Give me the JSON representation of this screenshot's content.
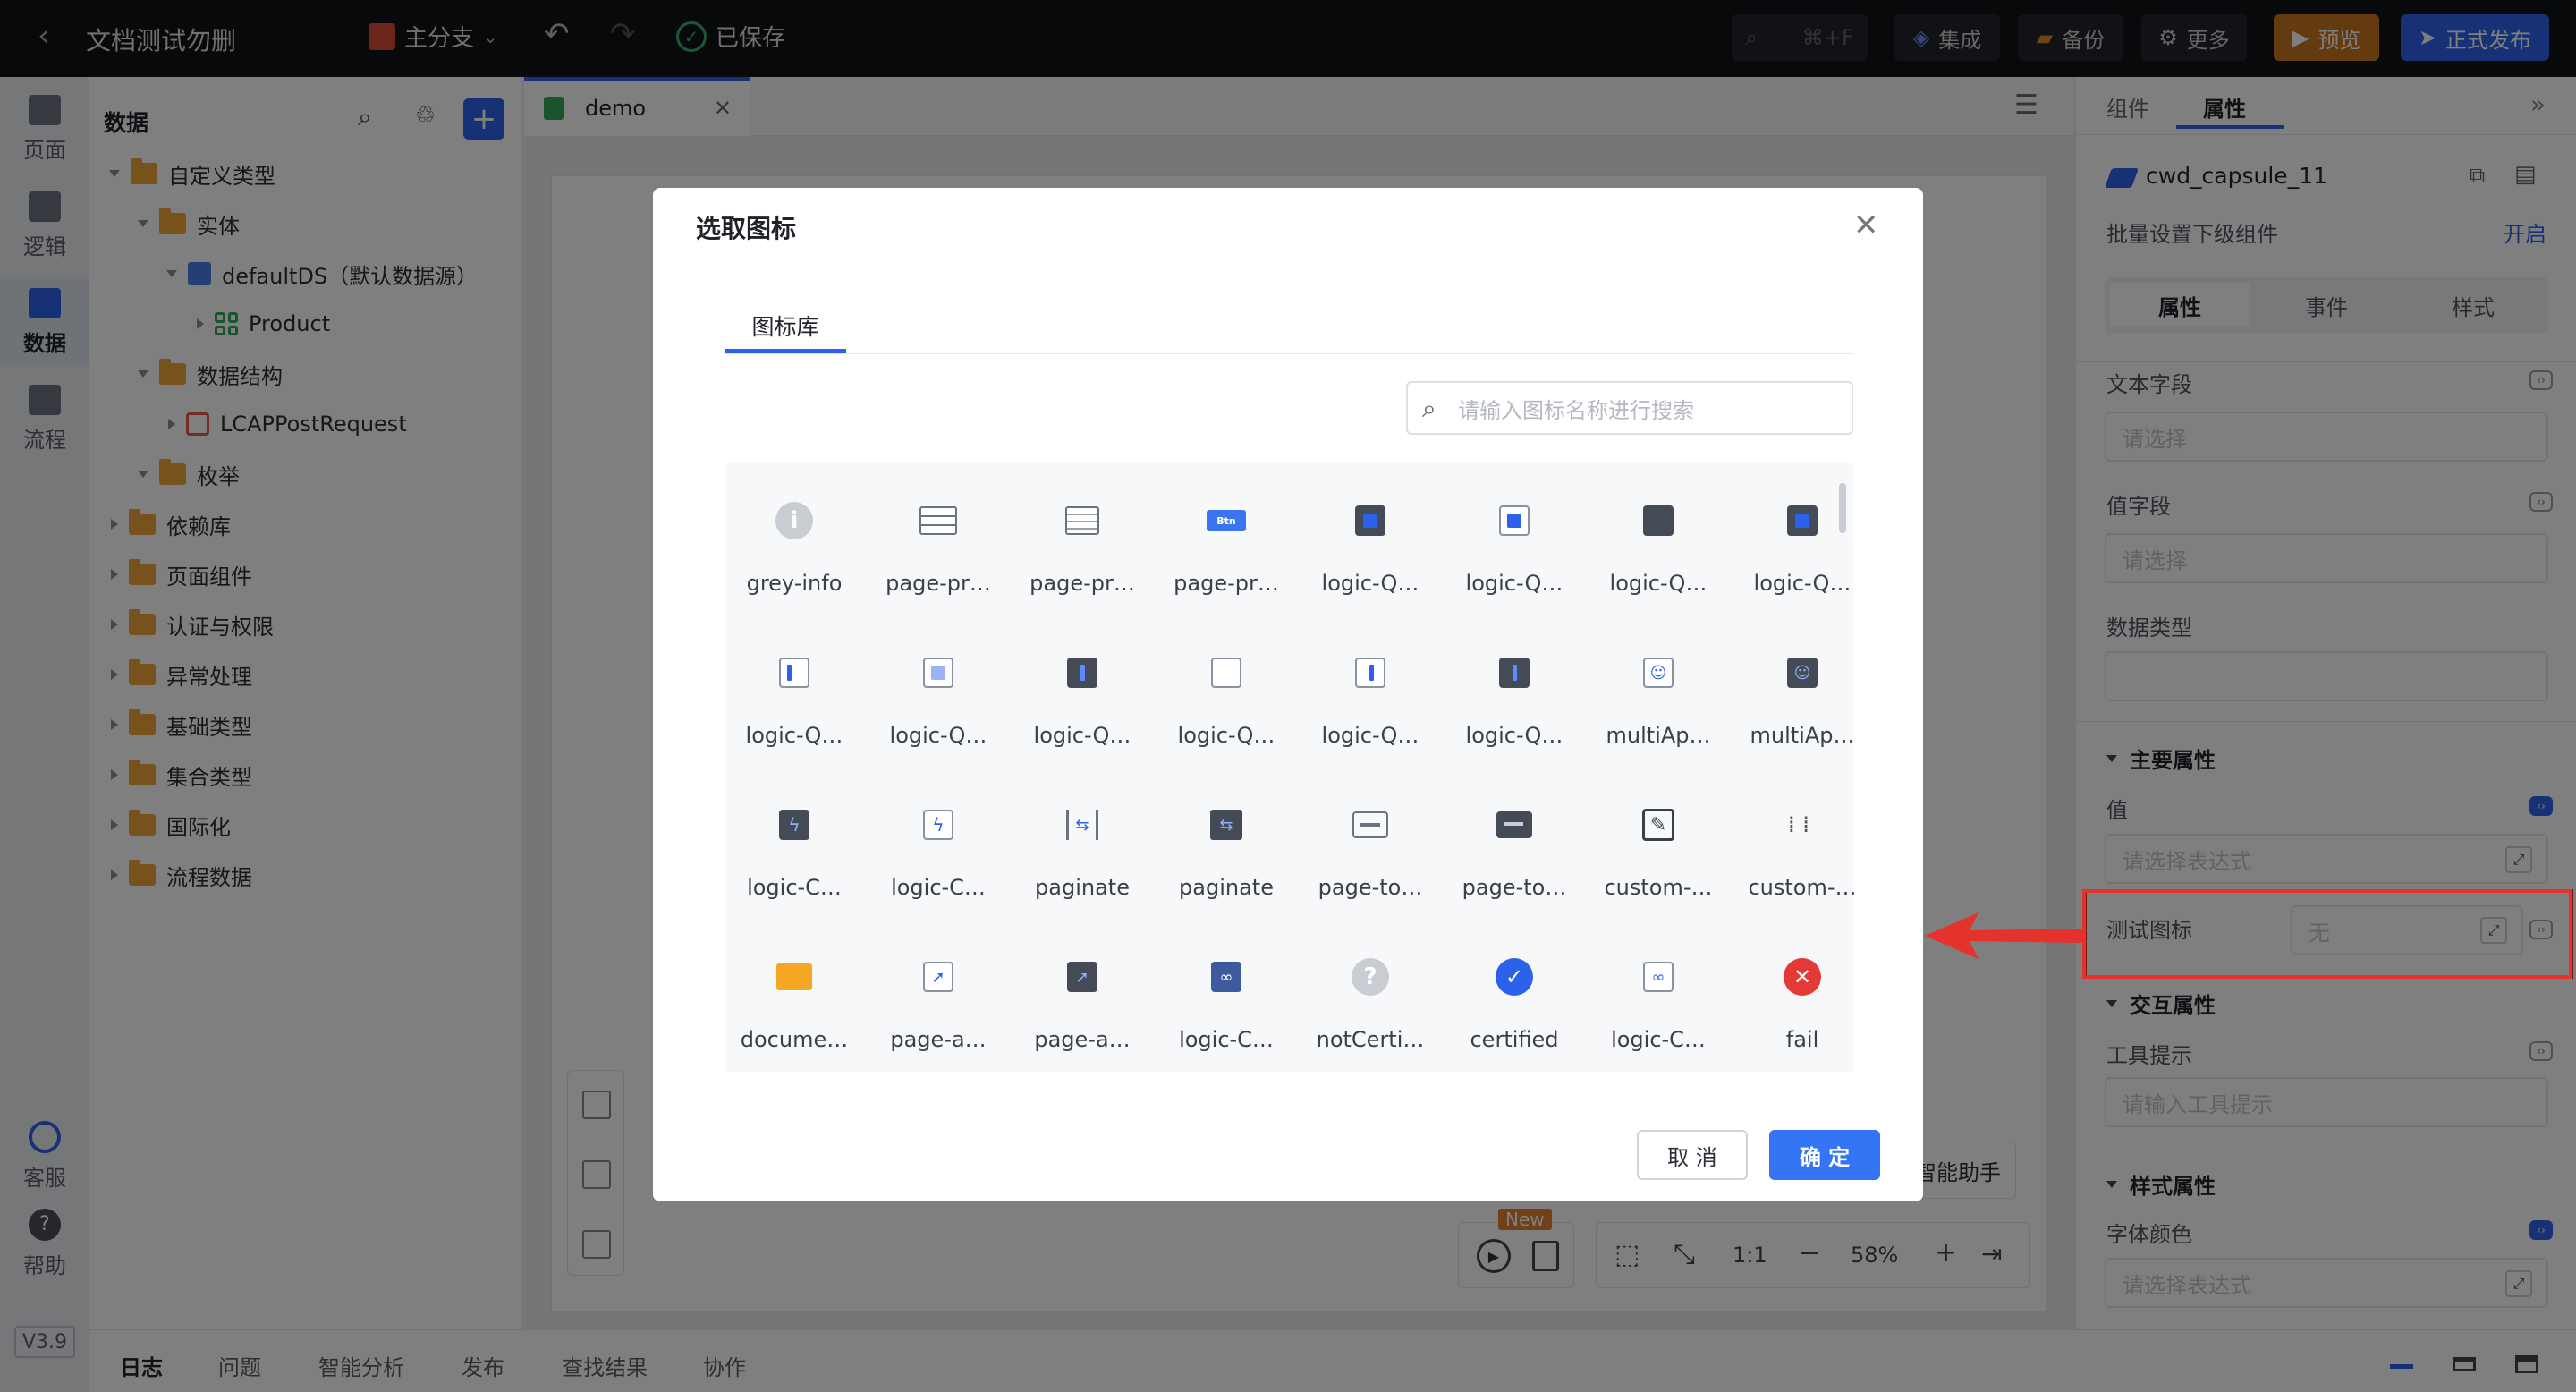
{
  "topbar": {
    "back": "‹",
    "project_title": "文档测试勿删",
    "branch": "主分支",
    "saved": "已保存",
    "search_shortcut": "⌘+F",
    "integrate": "集成",
    "backup": "备份",
    "more": "更多",
    "preview": "预览",
    "publish": "正式发布"
  },
  "left_rail": {
    "items": [
      {
        "label": "页面",
        "icon": "file-icon"
      },
      {
        "label": "逻辑",
        "icon": "logic-icon"
      },
      {
        "label": "数据",
        "icon": "database-icon"
      },
      {
        "label": "流程",
        "icon": "flow-icon"
      }
    ],
    "support": "客服",
    "help": "帮助",
    "version": "V3.9"
  },
  "tree": {
    "title": "数据",
    "rows": [
      {
        "label": "自定义类型",
        "icon": "folder",
        "expanded": true
      },
      {
        "label": "实体",
        "icon": "folder",
        "expanded": true
      },
      {
        "label": "defaultDS（默认数据源）",
        "icon": "db",
        "expanded": true
      },
      {
        "label": "Product",
        "icon": "entity",
        "expanded": false
      },
      {
        "label": "数据结构",
        "icon": "folder",
        "expanded": true
      },
      {
        "label": "LCAPPostRequest",
        "icon": "struct",
        "expanded": false
      },
      {
        "label": "枚举",
        "icon": "folder",
        "expanded": true
      },
      {
        "label": "依赖库",
        "icon": "folder",
        "expanded": false
      },
      {
        "label": "页面组件",
        "icon": "folder",
        "expanded": false
      },
      {
        "label": "认证与权限",
        "icon": "folder",
        "expanded": false
      },
      {
        "label": "异常处理",
        "icon": "folder",
        "expanded": false
      },
      {
        "label": "基础类型",
        "icon": "folder",
        "expanded": false
      },
      {
        "label": "集合类型",
        "icon": "folder",
        "expanded": false
      },
      {
        "label": "国际化",
        "icon": "folder",
        "expanded": false
      },
      {
        "label": "流程数据",
        "icon": "folder",
        "expanded": false
      }
    ]
  },
  "editor": {
    "tab": "demo",
    "assistant": "智能助手",
    "new_badge": "New",
    "ratio": "1:1",
    "zoom": "58%"
  },
  "right_panel": {
    "tabs": [
      "组件",
      "属性"
    ],
    "component_name": "cwd_capsule_11",
    "batch_label": "批量设置下级组件",
    "batch_action": "开启",
    "sub_tabs": [
      "属性",
      "事件",
      "样式"
    ],
    "text_field": {
      "label": "文本字段",
      "placeholder": "请选择"
    },
    "value_field": {
      "label": "值字段",
      "placeholder": "请选择"
    },
    "data_type": {
      "label": "数据类型"
    },
    "main_section": "主要属性",
    "value": {
      "label": "值",
      "placeholder": "请选择表达式"
    },
    "test_icon": {
      "label": "测试图标",
      "value": "无"
    },
    "interact_section": "交互属性",
    "tooltip": {
      "label": "工具提示",
      "placeholder": "请输入工具提示"
    },
    "style_section": "样式属性",
    "font_color": {
      "label": "字体颜色",
      "placeholder": "请选择表达式"
    }
  },
  "bottom_bar": [
    "日志",
    "问题",
    "智能分析",
    "发布",
    "查找结果",
    "协作"
  ],
  "modal": {
    "title": "选取图标",
    "tab": "图标库",
    "search_placeholder": "请输入图标名称进行搜索",
    "cancel": "取 消",
    "ok": "确 定",
    "icons": [
      {
        "label": "grey-info",
        "glyph": "info"
      },
      {
        "label": "page-pr…",
        "glyph": "rows"
      },
      {
        "label": "page-pr…",
        "glyph": "list"
      },
      {
        "label": "page-pr…",
        "glyph": "btn"
      },
      {
        "label": "logic-Q…",
        "glyph": "sq-dark-blue"
      },
      {
        "label": "logic-Q…",
        "glyph": "sq-blue"
      },
      {
        "label": "logic-Q…",
        "glyph": "sq-dark"
      },
      {
        "label": "logic-Q…",
        "glyph": "sq-dark-blue"
      },
      {
        "label": "logic-Q…",
        "glyph": "bar"
      },
      {
        "label": "logic-Q…",
        "glyph": "sq-light"
      },
      {
        "label": "logic-Q…",
        "glyph": "bar-dark"
      },
      {
        "label": "logic-Q…",
        "glyph": "sq-empty"
      },
      {
        "label": "logic-Q…",
        "glyph": "bar-right"
      },
      {
        "label": "logic-Q…",
        "glyph": "bar-dark"
      },
      {
        "label": "multiAp…",
        "glyph": "users"
      },
      {
        "label": "multiAp…",
        "glyph": "users-dark"
      },
      {
        "label": "logic-C…",
        "glyph": "bolt-dark"
      },
      {
        "label": "logic-C…",
        "glyph": "bolt"
      },
      {
        "label": "paginate",
        "glyph": "split"
      },
      {
        "label": "paginate",
        "glyph": "split-dark"
      },
      {
        "label": "page-to…",
        "glyph": "card"
      },
      {
        "label": "page-to…",
        "glyph": "card-dark"
      },
      {
        "label": "custom-…",
        "glyph": "edit"
      },
      {
        "label": "custom-…",
        "glyph": "dots"
      },
      {
        "label": "docume…",
        "glyph": "folder"
      },
      {
        "label": "page-a…",
        "glyph": "cursor"
      },
      {
        "label": "page-a…",
        "glyph": "cursor-dark"
      },
      {
        "label": "logic-C…",
        "glyph": "link-dark"
      },
      {
        "label": "notCerti…",
        "glyph": "question"
      },
      {
        "label": "certified",
        "glyph": "check"
      },
      {
        "label": "logic-C…",
        "glyph": "link"
      },
      {
        "label": "fail",
        "glyph": "fail"
      }
    ]
  },
  "colors": {
    "accent": "#2c62ea",
    "preview": "#d9842a",
    "publish": "#2c62ea",
    "highlight_border": "#e5322d"
  }
}
